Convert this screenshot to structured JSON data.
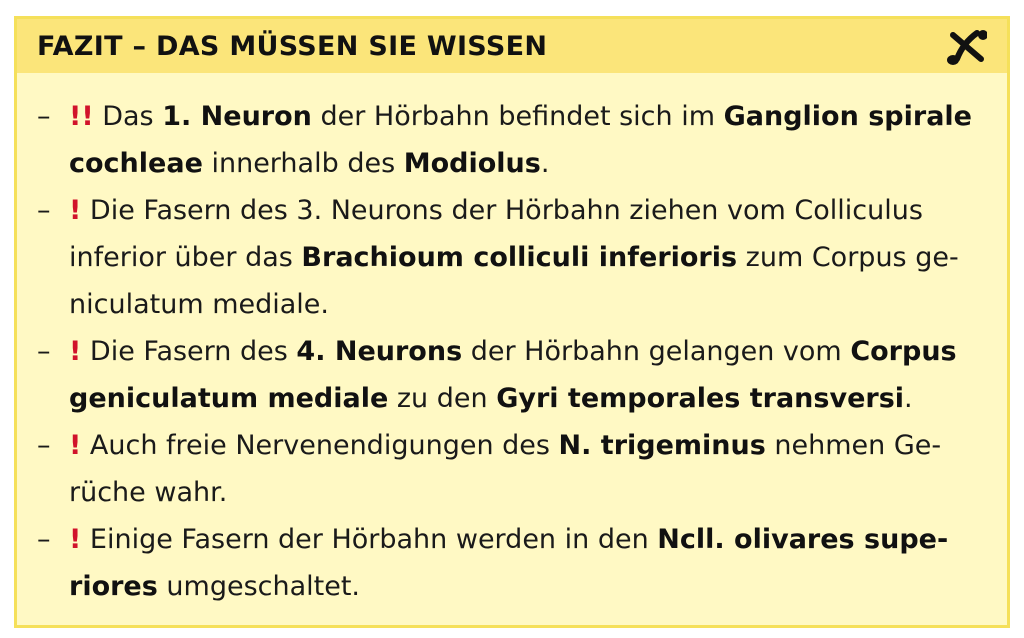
{
  "box": {
    "title": "FAZIT – DAS MÜSSEN SIE WISSEN",
    "icon": "scissors-icon",
    "accent_color": "#d1132b",
    "background_color": "#fff9c4",
    "header_color": "#fbe57a"
  },
  "items": [
    {
      "dash": "–",
      "mark": "!!",
      "segments": [
        {
          "t": " Das ",
          "b": false
        },
        {
          "t": "1. Neuron",
          "b": true
        },
        {
          "t": " der Hörbahn befindet sich im ",
          "b": false
        },
        {
          "t": "Ganglion spira­le cochleae",
          "b": true
        },
        {
          "t": " innerhalb des ",
          "b": false
        },
        {
          "t": "Modiolus",
          "b": true
        },
        {
          "t": ".",
          "b": false
        }
      ]
    },
    {
      "dash": "–",
      "mark": "!",
      "segments": [
        {
          "t": " Die Fasern des 3. Neurons der Hörbahn ziehen vom Colliculus inferior über das ",
          "b": false
        },
        {
          "t": "Brachioum colliculi inferioris",
          "b": true
        },
        {
          "t": " zum Corpus ge­niculatum mediale.",
          "b": false
        }
      ]
    },
    {
      "dash": "–",
      "mark": "!",
      "segments": [
        {
          "t": " Die Fasern des ",
          "b": false
        },
        {
          "t": "4. Neurons",
          "b": true
        },
        {
          "t": " der Hörbahn gelangen vom ",
          "b": false
        },
        {
          "t": "Corpus geniculatum mediale",
          "b": true
        },
        {
          "t": " zu den ",
          "b": false
        },
        {
          "t": "Gyri temporales transversi",
          "b": true
        },
        {
          "t": ".",
          "b": false
        }
      ]
    },
    {
      "dash": "–",
      "mark": "!",
      "segments": [
        {
          "t": " Auch freie Nervenendigungen des ",
          "b": false
        },
        {
          "t": "N. trigeminus",
          "b": true
        },
        {
          "t": " nehmen Ge­rüche wahr.",
          "b": false
        }
      ]
    },
    {
      "dash": "–",
      "mark": "!",
      "segments": [
        {
          "t": " Einige Fasern der Hörbahn werden in den ",
          "b": false
        },
        {
          "t": "Ncll. olivares supe­riores",
          "b": true
        },
        {
          "t": " umgeschaltet.",
          "b": false
        }
      ]
    }
  ]
}
